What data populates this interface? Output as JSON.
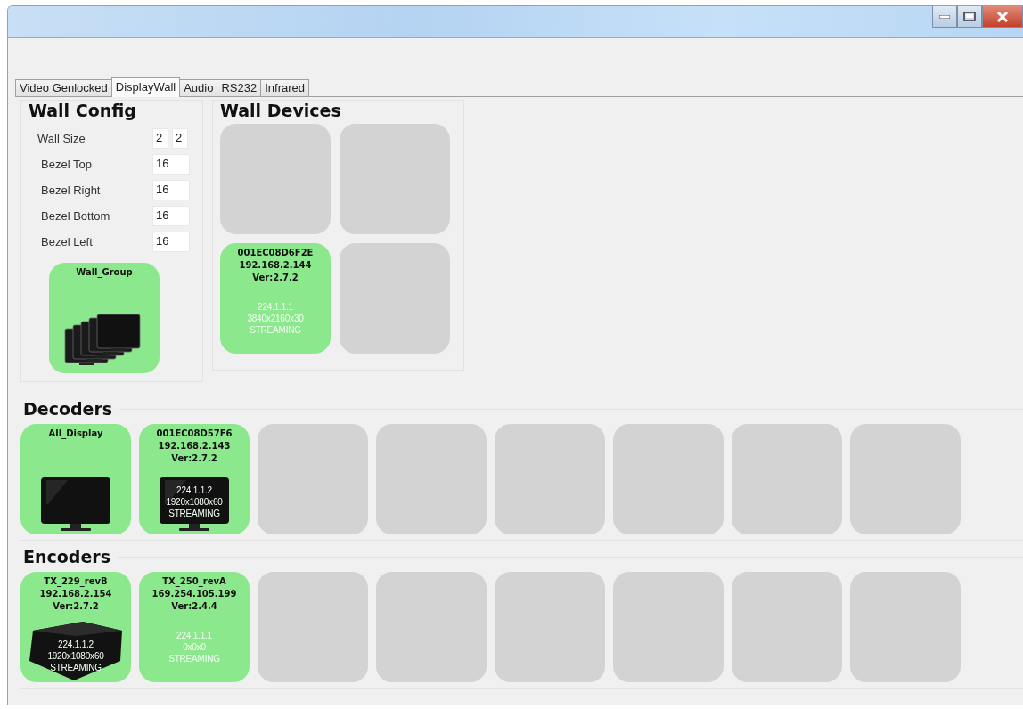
{
  "tabs": [
    {
      "label": "Video Genlocked",
      "selected": false
    },
    {
      "label": "DisplayWall",
      "selected": true
    },
    {
      "label": "Audio",
      "selected": false
    },
    {
      "label": "RS232",
      "selected": false
    },
    {
      "label": "Infrared",
      "selected": false
    }
  ],
  "wall_config": {
    "title": "Wall Config",
    "fields": [
      {
        "label": "Wall Size",
        "values": [
          "2",
          "2"
        ]
      },
      {
        "label": "Bezel Top",
        "values": [
          "16"
        ]
      },
      {
        "label": "Bezel Right",
        "values": [
          "16"
        ]
      },
      {
        "label": "Bezel Bottom",
        "values": [
          "16"
        ]
      },
      {
        "label": "Bezel Left",
        "values": [
          "16"
        ]
      }
    ],
    "group_tile": {
      "kind": "wall-group",
      "lines": [
        "Wall_Group"
      ]
    }
  },
  "wall_devices": {
    "title": "Wall Devices",
    "tiles": [
      {
        "kind": "empty"
      },
      {
        "kind": "empty"
      },
      {
        "kind": "device",
        "lines": [
          "001EC08D6F2E",
          "192.168.2.144",
          "Ver:2.7.2"
        ],
        "status": [
          "224.1.1.1",
          "3840x2160x30",
          "STREAMING"
        ]
      },
      {
        "kind": "empty"
      }
    ]
  },
  "decoders": {
    "title": "Decoders",
    "tiles": [
      {
        "kind": "display",
        "lines": [
          "All_Display"
        ]
      },
      {
        "kind": "display",
        "lines": [
          "001EC08D57F6",
          "192.168.2.143",
          "Ver:2.7.2"
        ],
        "status": [
          "224.1.1.2",
          "1920x1080x60",
          "STREAMING"
        ]
      },
      {
        "kind": "empty"
      },
      {
        "kind": "empty"
      },
      {
        "kind": "empty"
      },
      {
        "kind": "empty"
      },
      {
        "kind": "empty"
      },
      {
        "kind": "empty"
      }
    ]
  },
  "encoders": {
    "title": "Encoders",
    "tiles": [
      {
        "kind": "encoder",
        "lines": [
          "TX_229_revB",
          "192.168.2.154",
          "Ver:2.7.2"
        ],
        "status": [
          "224.1.1.2",
          "1920x1080x60",
          "STREAMING"
        ]
      },
      {
        "kind": "device",
        "lines": [
          "TX_250_revA",
          "169.254.105.199",
          "Ver:2.4.4"
        ],
        "status": [
          "224.1.1.1",
          "0x0x0",
          "STREAMING"
        ]
      },
      {
        "kind": "empty"
      },
      {
        "kind": "empty"
      },
      {
        "kind": "empty"
      },
      {
        "kind": "empty"
      },
      {
        "kind": "empty"
      },
      {
        "kind": "empty"
      }
    ]
  }
}
